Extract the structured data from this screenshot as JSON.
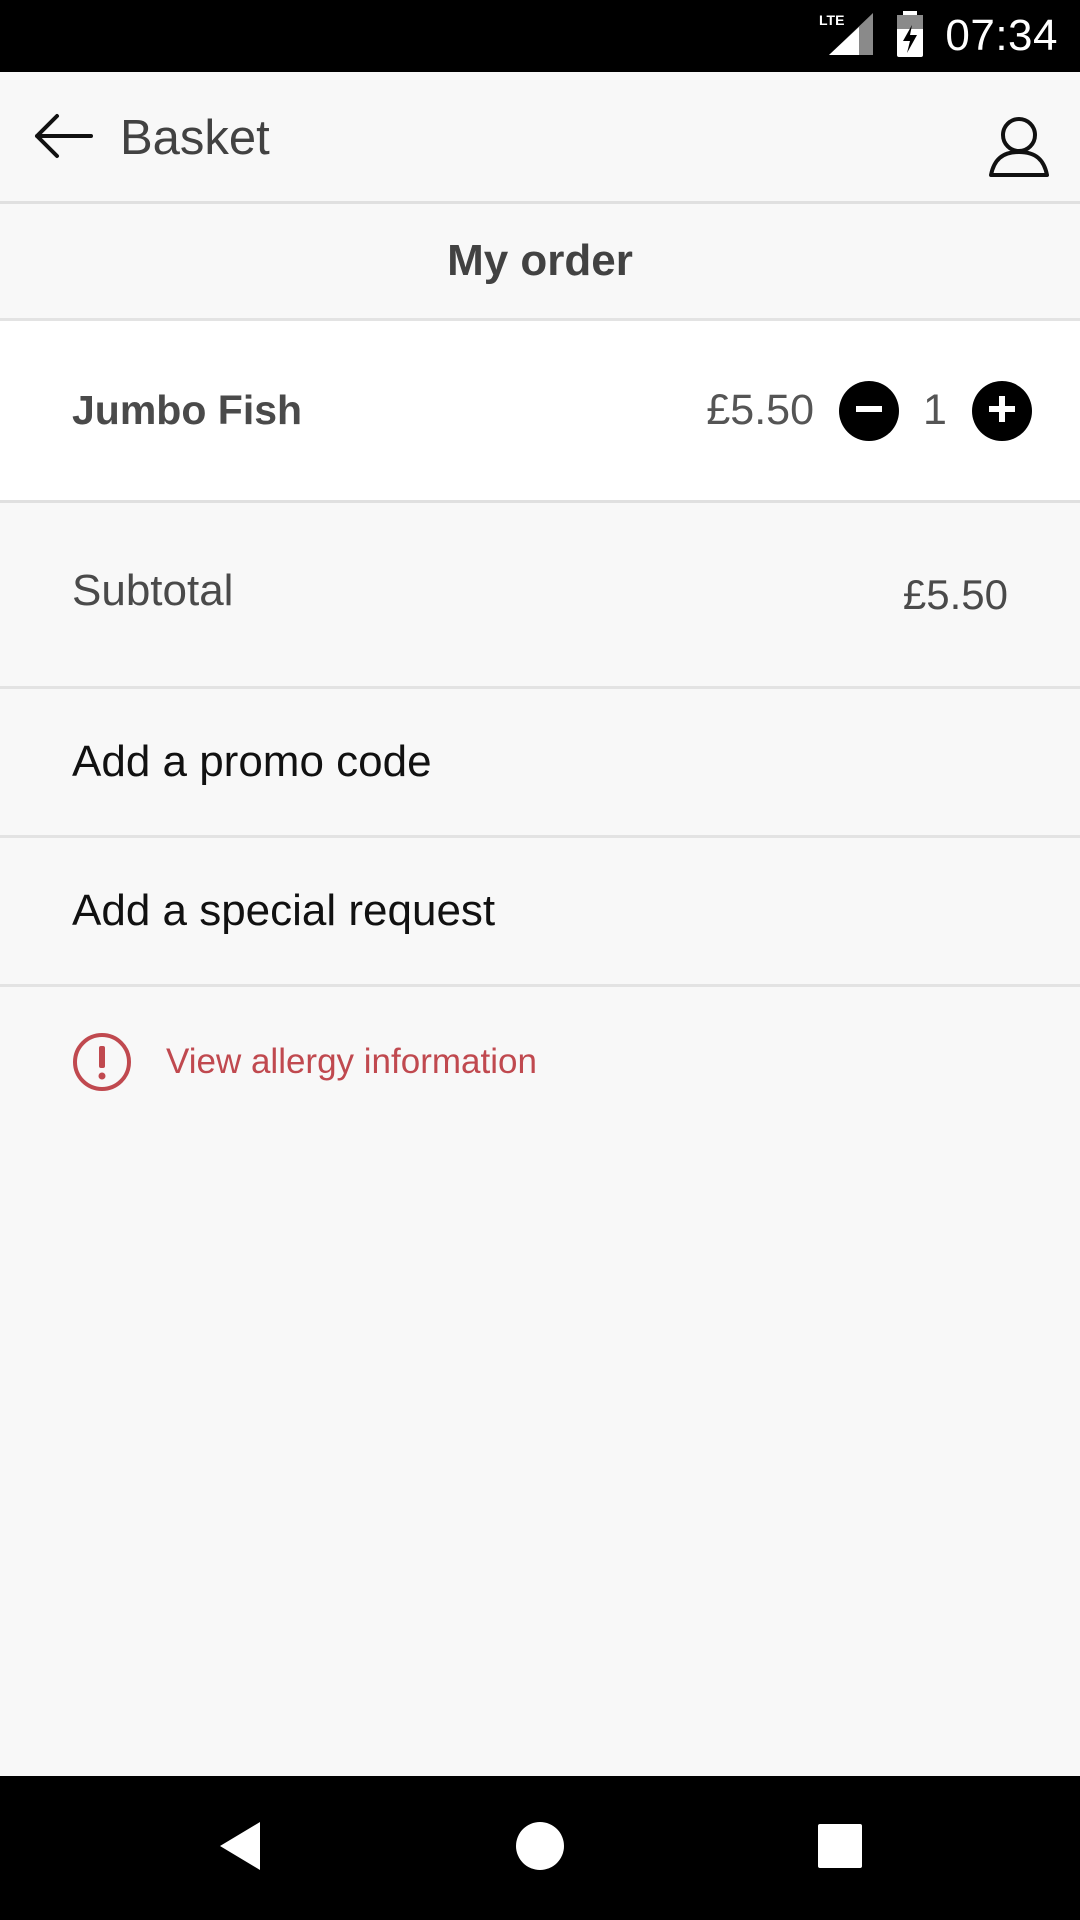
{
  "status_bar": {
    "network": "LTE",
    "time": "07:34"
  },
  "app_bar": {
    "title": "Basket",
    "back_icon": "arrow-left-icon",
    "account_icon": "person-icon"
  },
  "order": {
    "heading": "My order",
    "items": [
      {
        "name": "Jumbo Fish",
        "price": "£5.50",
        "quantity": "1"
      }
    ]
  },
  "summary": {
    "subtotal_label": "Subtotal",
    "subtotal_value": "£5.50"
  },
  "actions": {
    "promo_label": "Add a promo code",
    "special_request_label": "Add a special request"
  },
  "allergy": {
    "label": "View allergy information",
    "color": "#c0494f"
  },
  "nav_bar": {
    "back_icon": "triangle-back-icon",
    "home_icon": "circle-home-icon",
    "recents_icon": "square-recents-icon"
  }
}
